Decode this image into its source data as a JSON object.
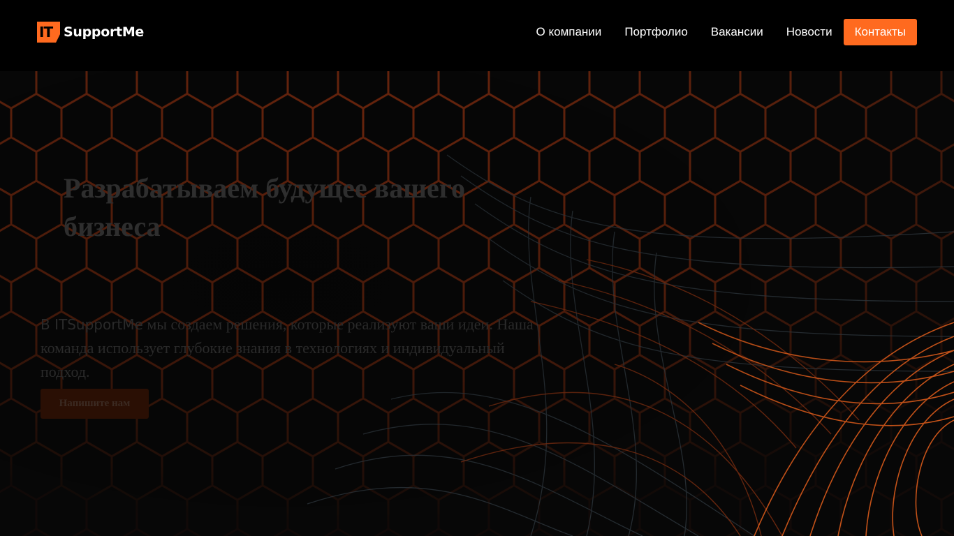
{
  "brand": {
    "mark": "IT",
    "name": "SupportMe",
    "accent_color": "#ff6a1f"
  },
  "nav": {
    "items": [
      "О компании",
      "Портфолио",
      "Вакансии",
      "Новости"
    ],
    "cta": "Контакты"
  },
  "hero": {
    "title": "Разрабатываем будущее вашего бизнеса",
    "text_brand": "В ITSupportMe",
    "text_rest": " мы создаем решения, которые реализуют ваши идеи. Наша команда использует глубокие знания в технологиях и индивидуальный подход.",
    "button": "Напишите нам"
  }
}
